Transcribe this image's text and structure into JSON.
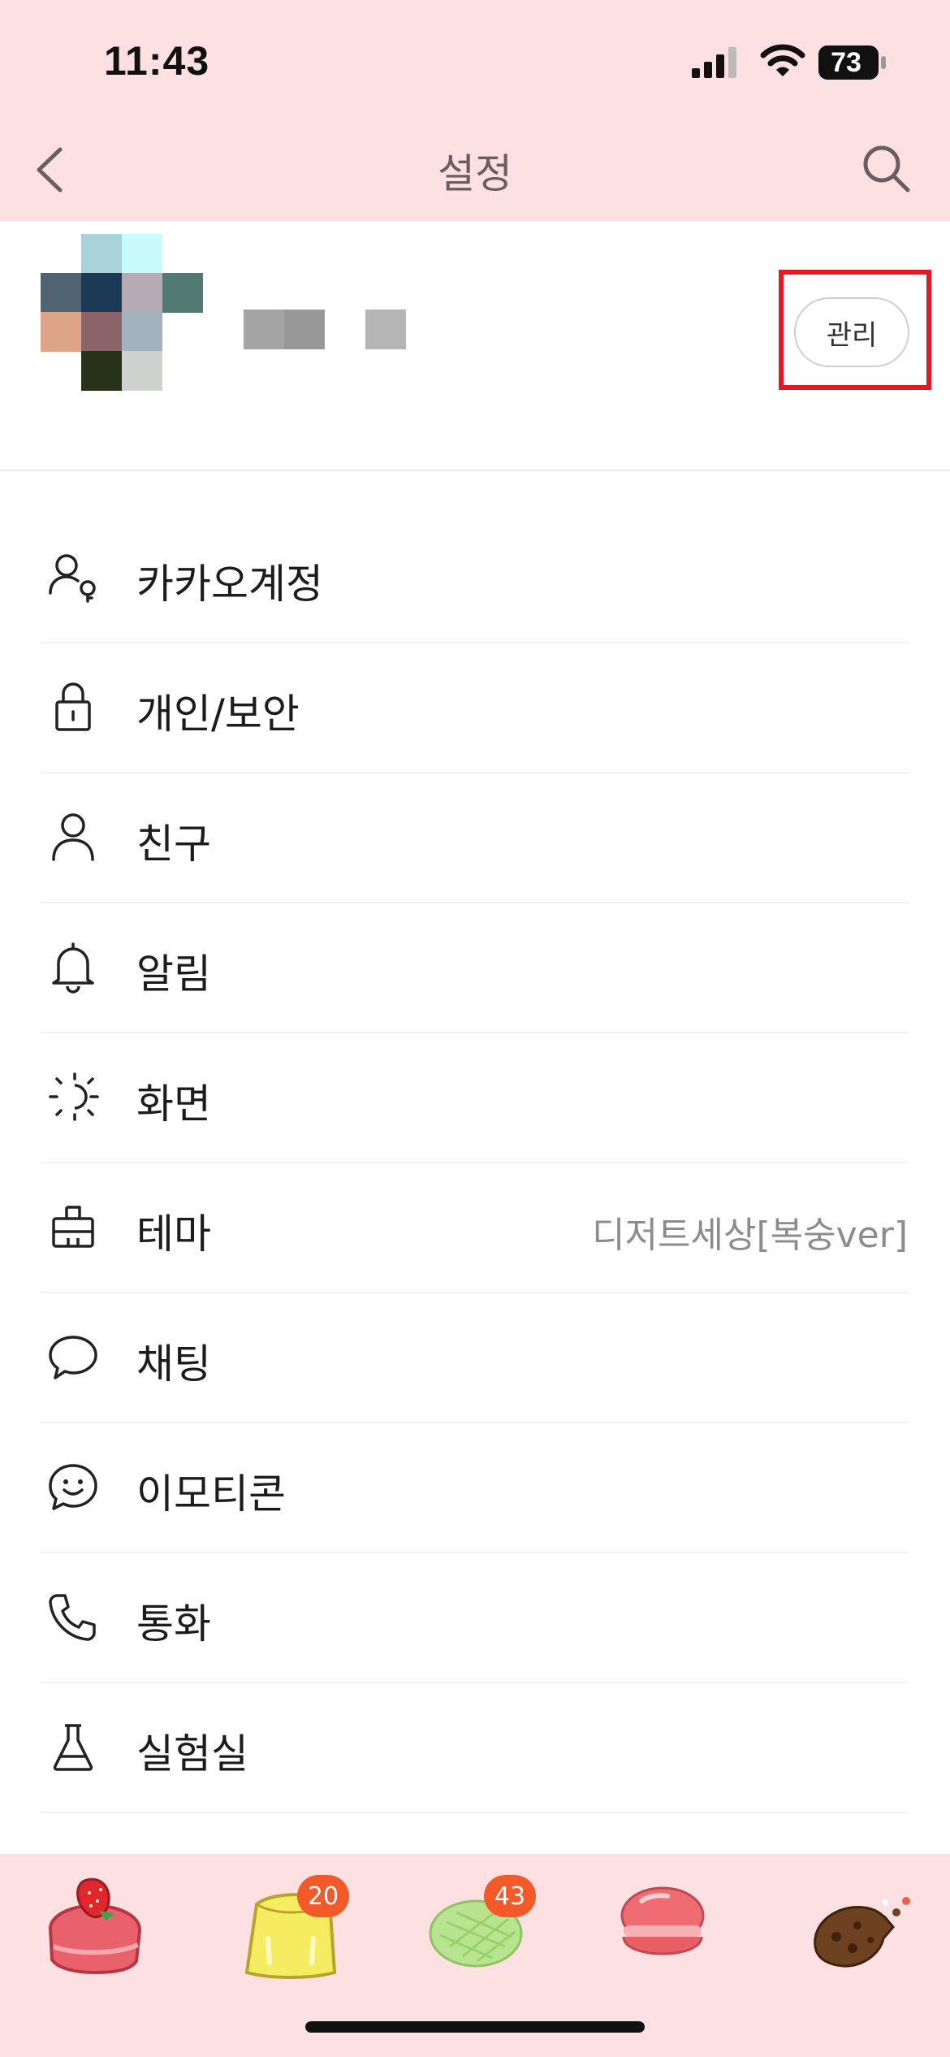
{
  "status_bar": {
    "time": "11:43",
    "battery": "73"
  },
  "nav": {
    "title": "설정"
  },
  "profile": {
    "manage_label": "관리"
  },
  "menu": [
    {
      "label": "카카오계정",
      "icon": "account-icon",
      "value": ""
    },
    {
      "label": "개인/보안",
      "icon": "lock-icon",
      "value": ""
    },
    {
      "label": "친구",
      "icon": "person-icon",
      "value": ""
    },
    {
      "label": "알림",
      "icon": "bell-icon",
      "value": ""
    },
    {
      "label": "화면",
      "icon": "display-icon",
      "value": ""
    },
    {
      "label": "테마",
      "icon": "theme-icon",
      "value": "디저트세상[복숭ver]"
    },
    {
      "label": "채팅",
      "icon": "chat-bubble-icon",
      "value": ""
    },
    {
      "label": "이모티콘",
      "icon": "emoticon-icon",
      "value": ""
    },
    {
      "label": "통화",
      "icon": "phone-icon",
      "value": ""
    },
    {
      "label": "실험실",
      "icon": "flask-icon",
      "value": ""
    }
  ],
  "dock": [
    {
      "name": "strawberry-cake-icon",
      "badge": ""
    },
    {
      "name": "pudding-icon",
      "badge": "20"
    },
    {
      "name": "melon-bread-icon",
      "badge": "43"
    },
    {
      "name": "macaron-icon",
      "badge": ""
    },
    {
      "name": "cookie-icon",
      "badge": ""
    }
  ],
  "colors": {
    "header_bg": "#fde0e2",
    "highlight": "#e01b24",
    "badge": "#f25a2a"
  }
}
